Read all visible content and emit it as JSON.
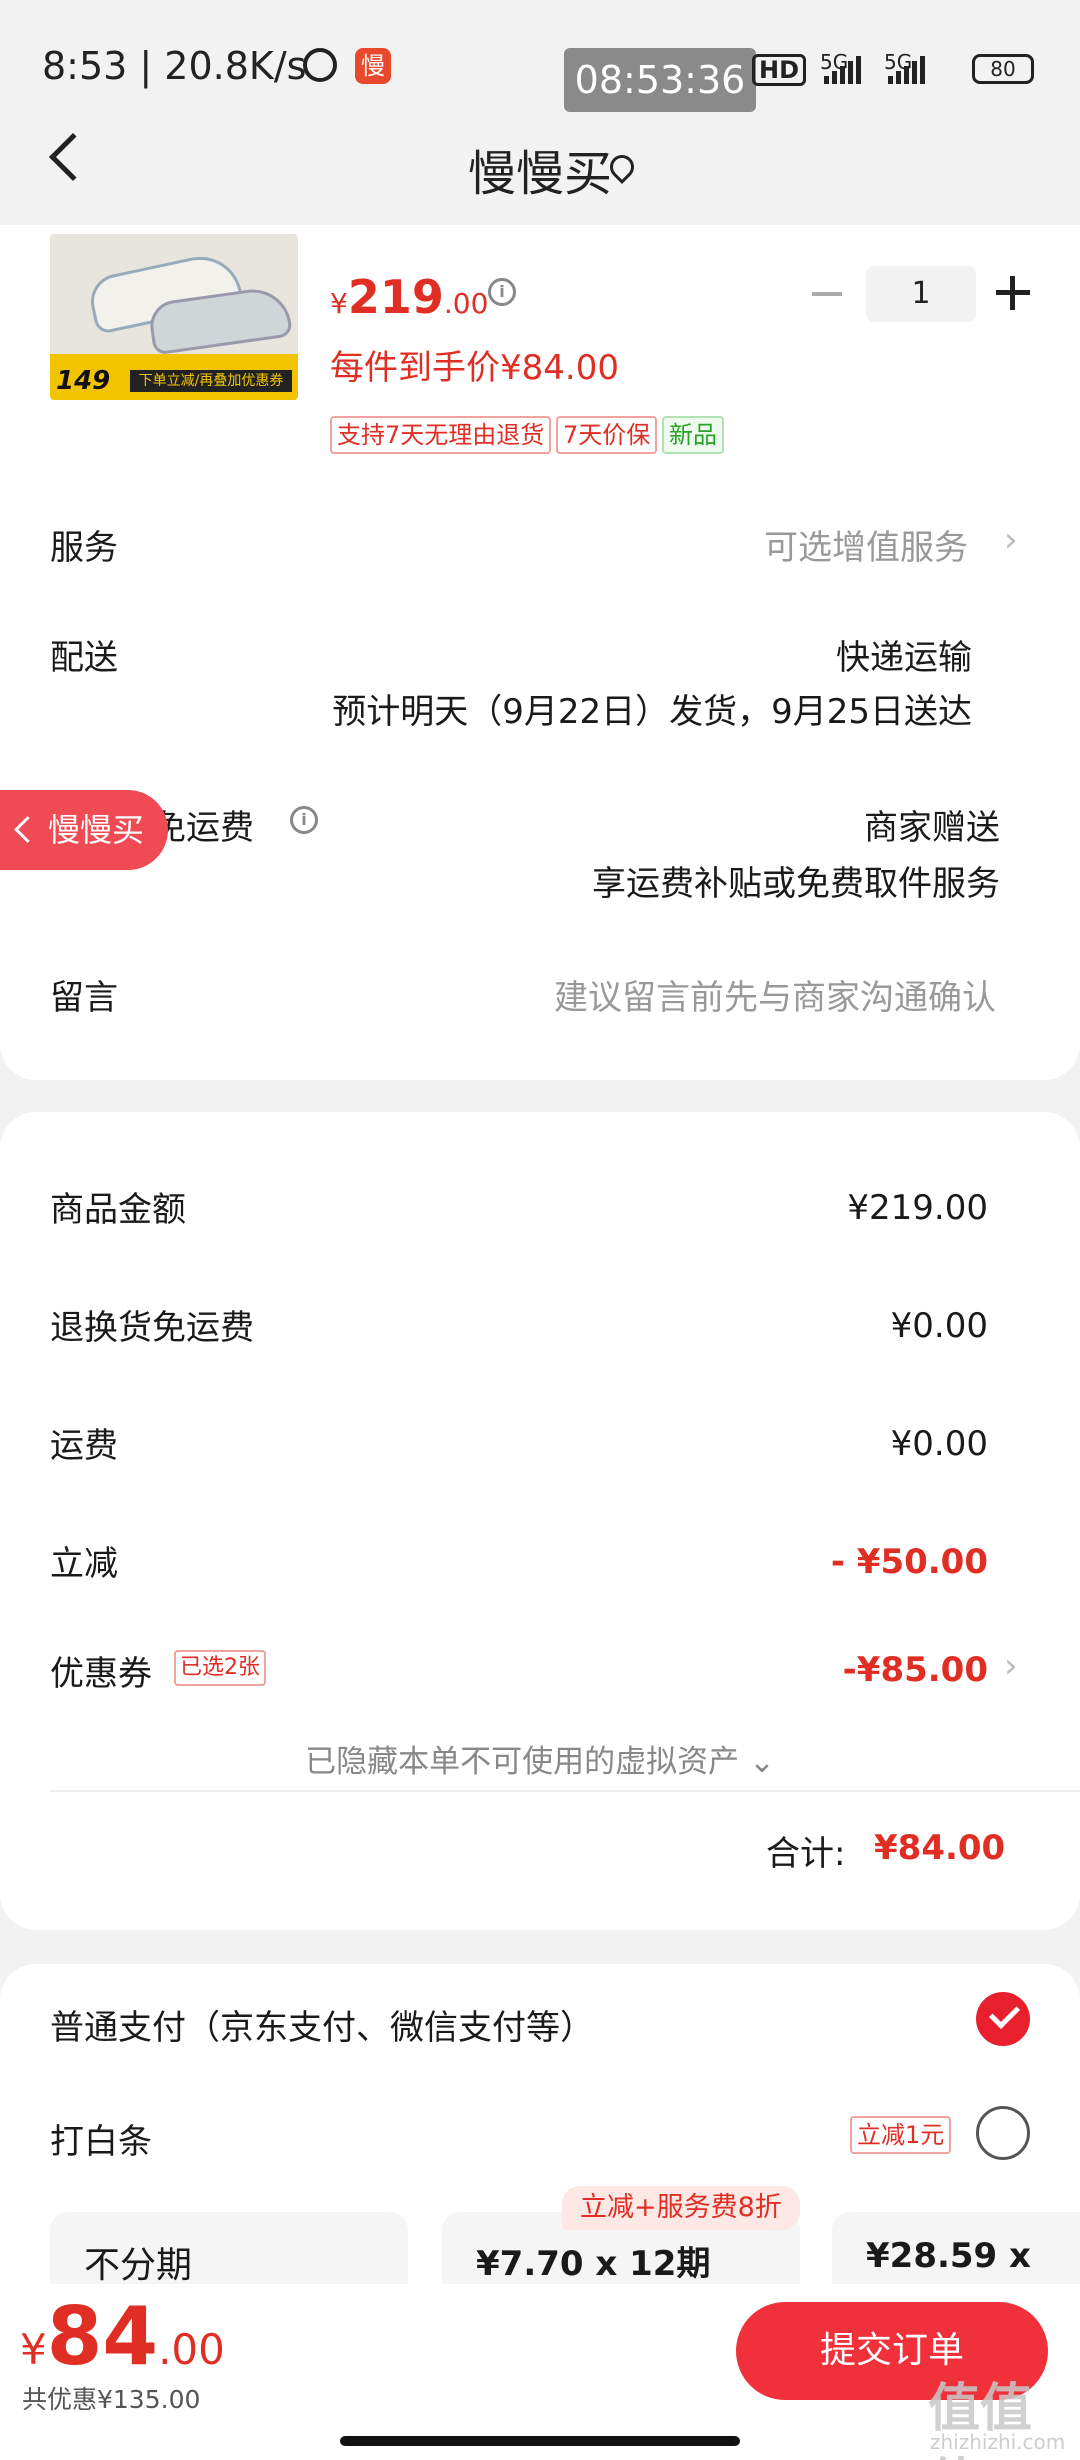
{
  "status_bar": {
    "time_speed": "8:53 | 20.8K/s",
    "app_badge": "慢",
    "clock": "08:53:36",
    "hd": "HD",
    "net1": "5G",
    "net2": "5G",
    "battery": "80"
  },
  "header": {
    "title": "慢慢买"
  },
  "product": {
    "thumb_price": "149",
    "thumb_banner": "下单立减/再叠加优惠券",
    "currency": "¥",
    "price_int": "219",
    "price_dec": ".00",
    "per_item": "每件到手价¥84.00",
    "quantity": "1",
    "tags": [
      "支持7天无理由退货",
      "7天价保",
      "新品"
    ]
  },
  "rows": {
    "service_label": "服务",
    "service_value": "可选增值服务",
    "delivery_label": "配送",
    "delivery_method": "快递运输",
    "delivery_eta": "预计明天（9月22日）发货，9月25日送达",
    "return_label": "退换货免运费",
    "return_value": "商家赠送",
    "return_desc": "享运费补贴或免费取件服务",
    "message_label": "留言",
    "message_placeholder": "建议留言前先与商家沟通确认",
    "float_pill": "慢慢买"
  },
  "amounts": {
    "goods_label": "商品金额",
    "goods_value": "¥219.00",
    "return_fee_label": "退换货免运费",
    "return_fee_value": "¥0.00",
    "shipping_label": "运费",
    "shipping_value": "¥0.00",
    "discount_label": "立减",
    "discount_value": "- ¥50.00",
    "coupon_label": "优惠券",
    "coupon_tag": "已选2张",
    "coupon_value": "-¥85.00",
    "hidden_note": "已隐藏本单不可使用的虚拟资产",
    "total_label": "合计:",
    "total_value": "¥84.00"
  },
  "payment": {
    "normal": "普通支付（京东支付、微信支付等）",
    "baitiao": "打白条",
    "baitiao_tag": "立减1元",
    "plan_badge": "立减+服务费8折",
    "plans": [
      "不分期",
      "¥7.70 x 12期",
      "¥28.59 x"
    ]
  },
  "bottom": {
    "currency": "¥",
    "total_int": "84",
    "total_dec": ".00",
    "saved": "共优惠¥135.00",
    "submit": "提交订单",
    "watermark": "值值值",
    "watermark_url": "zhizhizhi.com"
  },
  "colors": {
    "accent_red": "#e02e24",
    "button_red": "#f0303a",
    "badge_green": "#2aa22a"
  }
}
